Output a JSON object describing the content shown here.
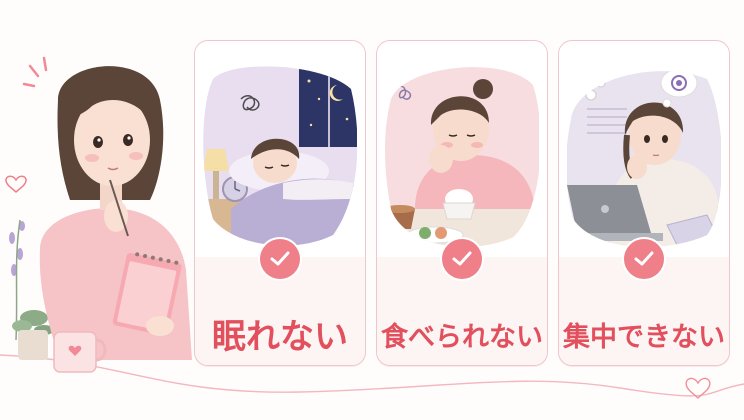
{
  "cards": [
    {
      "label": "眠れない",
      "scene": "lying-in-bed-at-night"
    },
    {
      "label": "食べられない",
      "scene": "no-appetite-at-table"
    },
    {
      "label": "集中できない",
      "scene": "distracted-at-laptop"
    }
  ],
  "colors": {
    "accent": "#e2505e",
    "check": "#ef7f89",
    "card_border": "#f0c6cc",
    "card_lower": "#fdf4f4"
  },
  "icons": [
    "check-icon",
    "heart-icon",
    "moon-icon",
    "star-icon",
    "alarm-clock-icon",
    "thought-bubble-icon"
  ]
}
